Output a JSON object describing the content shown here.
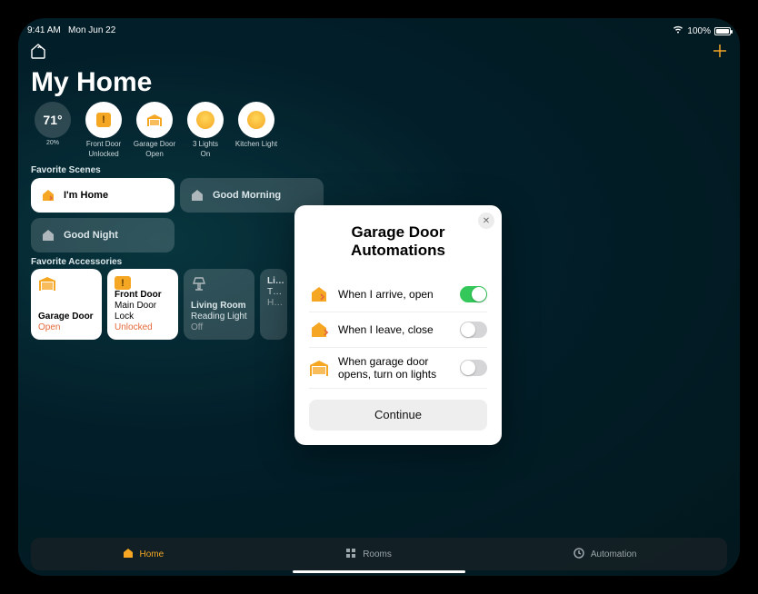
{
  "status_bar": {
    "time": "9:41 AM",
    "date": "Mon Jun 22",
    "battery": "100%"
  },
  "title": "My Home",
  "status_chips": {
    "temp": "71°",
    "humidity": "20%",
    "front_door_title": "Front Door",
    "front_door_sub": "Unlocked",
    "garage_title": "Garage Door",
    "garage_sub": "Open",
    "lights_title": "3 Lights",
    "lights_sub": "On",
    "kitchen_title": "Kitchen Light",
    "kitchen_sub": ""
  },
  "sections": {
    "scenes": "Favorite Scenes",
    "accessories": "Favorite Accessories"
  },
  "scenes": {
    "home": "I'm Home",
    "morning": "Good Morning",
    "night": "Good Night"
  },
  "cards": {
    "garage_name": "Garage Door",
    "garage_state": "Open",
    "front_name": "Front Door",
    "front_sub": "Main Door Lock",
    "front_state": "Unlocked",
    "living_name": "Living Room",
    "living_sub": "Reading Light",
    "living_state": "Off",
    "therm_name": "Li…",
    "therm_sub": "T…",
    "therm_state": "H…"
  },
  "tabs": {
    "home": "Home",
    "rooms": "Rooms",
    "automation": "Automation"
  },
  "modal": {
    "title": "Garage Door Automations",
    "row1": "When I arrive, open",
    "row2": "When I leave, close",
    "row3": "When garage door opens, turn on lights",
    "continue": "Continue"
  }
}
